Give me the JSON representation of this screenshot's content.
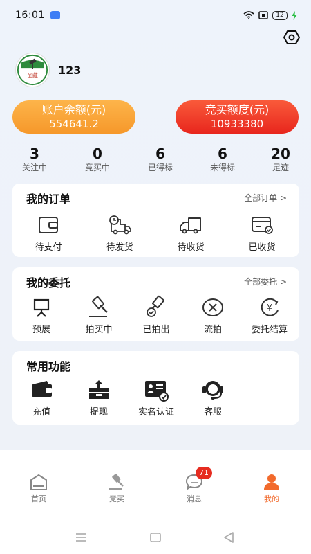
{
  "status_bar": {
    "time": "16:01",
    "battery": "12"
  },
  "profile": {
    "username": "123",
    "avatar_text": "品藏"
  },
  "balance": {
    "label": "账户余额(元)",
    "value": "554641.2"
  },
  "quota": {
    "label": "竞买额度(元)",
    "value": "10933380"
  },
  "stats": [
    {
      "num": "3",
      "label": "关注中"
    },
    {
      "num": "0",
      "label": "竞买中"
    },
    {
      "num": "6",
      "label": "已得标"
    },
    {
      "num": "6",
      "label": "未得标"
    },
    {
      "num": "20",
      "label": "足迹"
    }
  ],
  "orders": {
    "title": "我的订单",
    "more": "全部订单 >",
    "items": [
      {
        "label": "待支付",
        "icon": "wallet-icon"
      },
      {
        "label": "待发货",
        "icon": "truck-clock-icon"
      },
      {
        "label": "待收货",
        "icon": "delivery-truck-icon"
      },
      {
        "label": "已收货",
        "icon": "card-check-icon"
      }
    ]
  },
  "entrust": {
    "title": "我的委托",
    "more": "全部委托 >",
    "items": [
      {
        "label": "预展",
        "icon": "easel-icon"
      },
      {
        "label": "拍买中",
        "icon": "gavel-icon"
      },
      {
        "label": "已拍出",
        "icon": "gavel-check-icon"
      },
      {
        "label": "流拍",
        "icon": "cancel-circle-icon"
      },
      {
        "label": "委托结算",
        "icon": "yen-refresh-icon"
      }
    ]
  },
  "functions": {
    "title": "常用功能",
    "items": [
      {
        "label": "充值",
        "icon": "wallet-dark-icon"
      },
      {
        "label": "提现",
        "icon": "withdraw-icon"
      },
      {
        "label": "实名认证",
        "icon": "id-card-icon"
      },
      {
        "label": "客服",
        "icon": "headset-icon"
      }
    ]
  },
  "tabbar": {
    "items": [
      {
        "label": "首页",
        "icon": "home-icon"
      },
      {
        "label": "竞买",
        "icon": "gavel-icon"
      },
      {
        "label": "消息",
        "icon": "chat-icon",
        "badge": "71"
      },
      {
        "label": "我的",
        "icon": "person-icon",
        "active": true
      }
    ]
  },
  "colors": {
    "accent": "#f26a2c",
    "balance": "#f6982a",
    "quota": "#e8261d",
    "badge": "#e62c20"
  }
}
